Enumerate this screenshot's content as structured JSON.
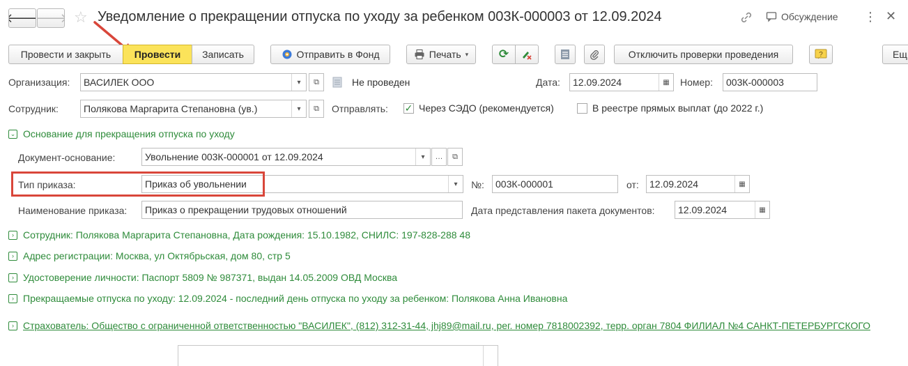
{
  "window": {
    "title": "Уведомление о прекращении отпуска по уходу за ребенком 003К-000003 от 12.09.2024",
    "discussion_label": "Обсуждение"
  },
  "toolbar": {
    "post_close": "Провести и закрыть",
    "post": "Провести",
    "save": "Записать",
    "send_fund": "Отправить в Фонд",
    "print": "Печать",
    "disable_checks": "Отключить проверки проведения",
    "more_trunc": "Ещ"
  },
  "header": {
    "org_label": "Организация:",
    "org_value": "ВАСИЛЕК ООО",
    "status": "Не проведен",
    "date_label": "Дата:",
    "date_value": "12.09.2024",
    "number_label": "Номер:",
    "number_value": "003К-000003",
    "employee_label": "Сотрудник:",
    "employee_value": "Полякова Маргарита Степановна (ув.)",
    "send_label": "Отправлять:",
    "send_sedo": "Через СЭДО (рекомендуется)",
    "send_sedo_checked": true,
    "send_registry": "В реестре прямых выплат (до 2022 г.)",
    "send_registry_checked": false
  },
  "basis": {
    "section_title": "Основание для прекращения отпуска по уходу",
    "doc_label": "Документ-основание:",
    "doc_value": "Увольнение 003К-000001 от 12.09.2024",
    "order_type_label": "Тип приказа:",
    "order_type_value": "Приказ об увольнении",
    "order_no_label": "№:",
    "order_no_value": "003К-000001",
    "order_from_label": "от:",
    "order_from_value": "12.09.2024",
    "order_name_label": "Наименование приказа:",
    "order_name_value": "Приказ о прекращении трудовых отношений",
    "package_date_label": "Дата представления пакета документов:",
    "package_date_value": "12.09.2024"
  },
  "sections": [
    "Сотрудник: Полякова Маргарита Степановна, Дата рождения: 15.10.1982, СНИЛС: 197-828-288 48",
    "Адрес регистрации: Москва, ул Октябрьская, дом 80, стр 5",
    "Удостоверение личности: Паспорт 5809 № 987371, выдан 14.05.2009 ОВД Москва",
    "Прекращаемые отпуска по уходу: 12.09.2024 - последний день отпуска по уходу за ребенком: Полякова Анна Ивановна"
  ],
  "insurer": "Страхователь: Общество с ограниченной ответственностью \"ВАСИЛЕК\", (812) 312-31-44, jhj89@mail.ru, рег. номер 7818002392, терр. орган 7804 ФИЛИАЛ №4 САНКТ-ПЕТЕРБУРГСКОГО",
  "colors": {
    "accent_green": "#2e8b3a",
    "primary_button": "#fbe35a",
    "highlight_red": "#d9463a"
  }
}
